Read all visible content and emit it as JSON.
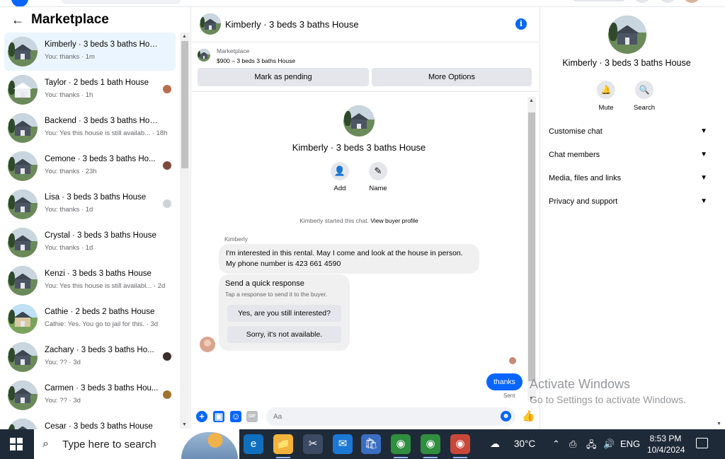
{
  "marketplace": {
    "title": "Marketplace",
    "conversations": [
      {
        "name": "Kimberly · 3 beds 3 baths House",
        "preview": "You: thanks · 1m",
        "active": true
      },
      {
        "name": "Taylor · 2 beds 1 bath House",
        "preview": "You: thanks · 1h"
      },
      {
        "name": "Backend · 3 beds 3 baths House",
        "preview": "You: Yes this house is still availab... · 18h"
      },
      {
        "name": "Cemone · 3 beds 3 baths Ho...",
        "preview": "You: thanks · 23h"
      },
      {
        "name": "Lisa · 3 beds 3 baths House",
        "preview": "You: thanks · 1d"
      },
      {
        "name": "Crystal · 3 beds 3 baths House",
        "preview": "You: thanks · 1d"
      },
      {
        "name": "Kenzi · 3 beds 3 baths House",
        "preview": "You: Yes this house is still availabl... · 2d"
      },
      {
        "name": "Cathie · 2 beds 2 baths House",
        "preview": "Cathie: Yes. You go to jail for this. · 3d"
      },
      {
        "name": "Zachary · 3 beds 3 baths Ho...",
        "preview": "You: ?? · 3d"
      },
      {
        "name": "Carmen · 3 beds 3 baths Hou...",
        "preview": "You: ?? · 3d"
      },
      {
        "name": "Cesar · 3 beds 3 baths House",
        "preview": ""
      }
    ]
  },
  "chat": {
    "title": "Kimberly · 3 beds 3 baths House",
    "info_icon": "info-icon",
    "listing_label": "Marketplace",
    "listing_price": "$900 – 3 beds 3 baths House",
    "mark_pending": "Mark as pending",
    "more_options": "More Options",
    "intro_name": "Kimberly · 3 beds 3 baths House",
    "add_label": "Add",
    "name_label": "Name",
    "started": "Kimberly started this chat.",
    "view_profile": "View buyer profile",
    "sender": "Kimberly",
    "message": "I'm interested in this rental. May I come and look at the house in person. My phone number is 423 661 4590",
    "quick_title": "Send a quick response",
    "quick_sub": "Tap a response to send it to the buyer.",
    "quick_opt1": "Yes, are you still interested?",
    "quick_opt2": "Sorry, it's not available.",
    "sent_text": "thanks",
    "sent_status": "Sent",
    "composer_placeholder": "Aa",
    "gif_label": "GIF"
  },
  "details": {
    "name": "Kimberly · 3 beds 3 baths House",
    "mute": "Mute",
    "search": "Search",
    "sections": [
      "Customise chat",
      "Chat members",
      "Media, files and links",
      "Privacy and support"
    ]
  },
  "watermark": {
    "line1": "Activate Windows",
    "line2": "Go to Settings to activate Windows."
  },
  "taskbar": {
    "search_placeholder": "Type here to search",
    "temperature": "30°C",
    "language": "ENG",
    "time": "8:53 PM",
    "date": "10/4/2024"
  },
  "colors": {
    "accent": "#0866ff",
    "active_row": "#ebf5ff",
    "taskbar": "#1f2a38"
  }
}
